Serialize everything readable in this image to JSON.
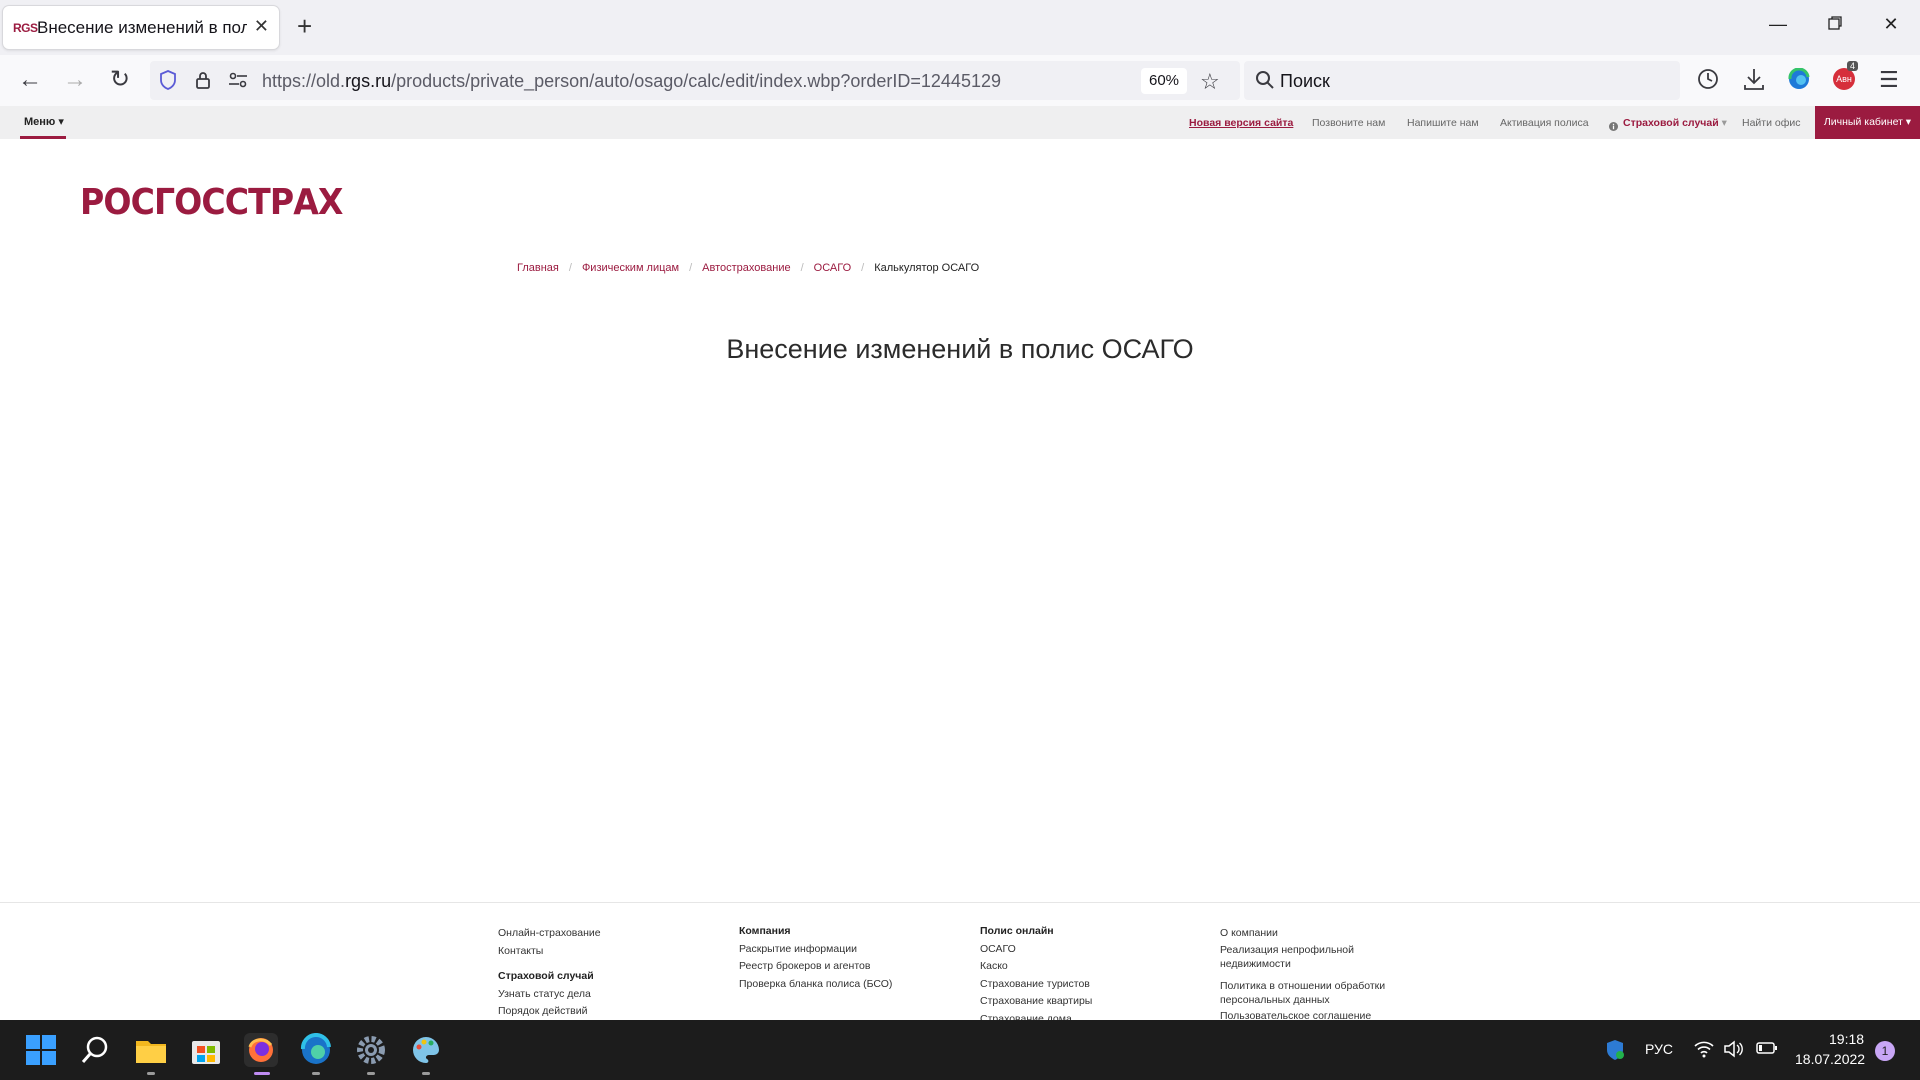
{
  "browser": {
    "tab_favicon": "RGS",
    "tab_title": "Внесение изменений в полис",
    "url_prefix": "https://old.",
    "url_host": "rgs.ru",
    "url_path": "/products/private_person/auto/osago/calc/edit/index.wbp?orderID=12445129",
    "zoom": "60%",
    "search_placeholder": "Поиск",
    "extension_badge": "4",
    "extension_label": "Авн"
  },
  "site_nav": {
    "menu_label": "Меню",
    "links": {
      "new_site": "Новая версия сайта",
      "call_us": "Позвоните нам",
      "write_us": "Напишите нам",
      "activate": "Активация полиса",
      "insurance_case": "Страховой случай",
      "find_office": "Найти офис",
      "cabinet": "Личный кабинет"
    }
  },
  "logo_text": "РОСГОССТРАХ",
  "breadcrumb": {
    "items": [
      "Главная",
      "Физическим лицам",
      "Автострахование",
      "ОСАГО"
    ],
    "current": "Калькулятор ОСАГО"
  },
  "page_title": "Внесение изменений в полис ОСАГО",
  "footer": {
    "col1": {
      "items_a": [
        "Онлайн-страхование",
        "Контакты"
      ],
      "heading_b": "Страховой случай",
      "items_b": [
        "Узнать статус дела",
        "Порядок действий"
      ]
    },
    "col2": {
      "heading": "Компания",
      "items": [
        "Раскрытие информации",
        "Реестр брокеров и агентов",
        "Проверка бланка полиса (БСО)"
      ]
    },
    "col3": {
      "heading": "Полис онлайн",
      "items": [
        "ОСАГО",
        "Каско",
        "Страхование туристов",
        "Страхование квартиры",
        "Страхование дома"
      ]
    },
    "col4": {
      "items": [
        "О компании",
        "Реализация непрофильной",
        "недвижимости",
        "Политика в отношении обработки",
        "персональных данных",
        "Пользовательское соглашение"
      ]
    }
  },
  "taskbar": {
    "language": "РУС",
    "time": "19:18",
    "date": "18.07.2022",
    "notification_count": "1"
  }
}
